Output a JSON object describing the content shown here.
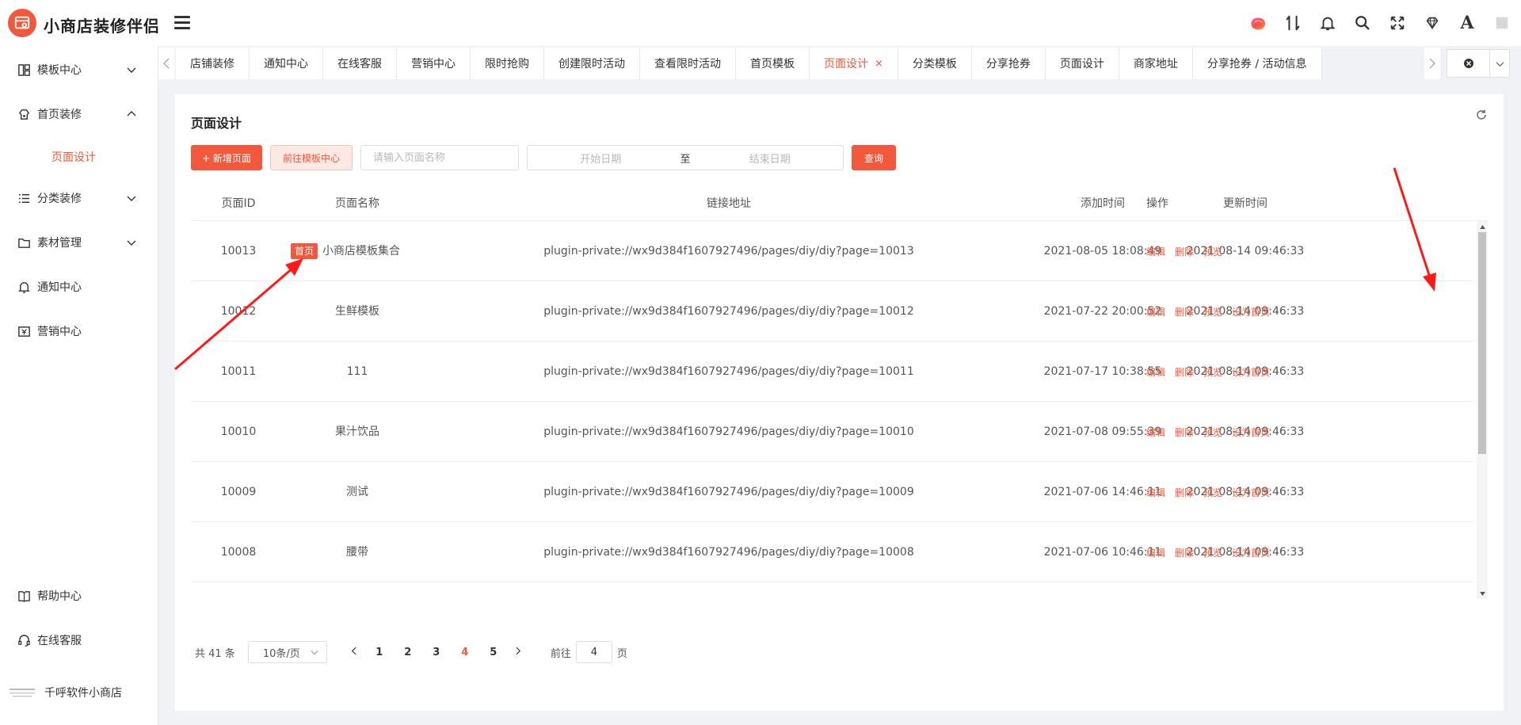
{
  "app": {
    "brand": "小商店装修伴侣"
  },
  "sidebar": {
    "items": [
      {
        "label": "模板中心"
      },
      {
        "label": "首页装修"
      },
      {
        "label": "页面设计"
      },
      {
        "label": "分类装修"
      },
      {
        "label": "素材管理"
      },
      {
        "label": "通知中心"
      },
      {
        "label": "营销中心"
      },
      {
        "label": "帮助中心"
      },
      {
        "label": "在线客服"
      }
    ],
    "footer": {
      "label": "千呼软件小商店"
    }
  },
  "tabs": [
    {
      "label": "店铺装修"
    },
    {
      "label": "通知中心"
    },
    {
      "label": "在线客服"
    },
    {
      "label": "营销中心"
    },
    {
      "label": "限时抢购"
    },
    {
      "label": "创建限时活动"
    },
    {
      "label": "查看限时活动"
    },
    {
      "label": "首页模板"
    },
    {
      "label": "页面设计",
      "close": "×"
    },
    {
      "label": "分类模板"
    },
    {
      "label": "分享抢券"
    },
    {
      "label": "页面设计"
    },
    {
      "label": "商家地址"
    },
    {
      "label": "分享抢券 / 活动信息"
    }
  ],
  "page": {
    "title": "页面设计",
    "add_button": "+ 新增页面",
    "template_button": "前往模板中心",
    "search_placeholder": "请输入页面名称",
    "start_date_placeholder": "开始日期",
    "date_separator": "至",
    "end_date_placeholder": "结束日期",
    "query_button": "查询"
  },
  "table": {
    "headers": {
      "id": "页面ID",
      "name": "页面名称",
      "link": "链接地址",
      "added": "添加时间",
      "updated": "更新时间",
      "ops": "操作"
    },
    "op_labels": {
      "edit": "编辑",
      "delete": "删除",
      "preview": "预览",
      "set_home": "设为首页"
    },
    "home_badge": "首页",
    "rows": [
      {
        "id": "10013",
        "name": "小商店模板集合",
        "link": "plugin-private://wx9d384f1607927496/pages/diy/diy?page=10013",
        "added": "2021-08-05 18:08:49",
        "updated": "2021-08-14 09:46:33",
        "is_home": true
      },
      {
        "id": "10012",
        "name": "生鲜模板",
        "link": "plugin-private://wx9d384f1607927496/pages/diy/diy?page=10012",
        "added": "2021-07-22 20:00:52",
        "updated": "2021-08-14 09:46:33",
        "is_home": false
      },
      {
        "id": "10011",
        "name": "111",
        "link": "plugin-private://wx9d384f1607927496/pages/diy/diy?page=10011",
        "added": "2021-07-17 10:38:55",
        "updated": "2021-08-14 09:46:33",
        "is_home": false
      },
      {
        "id": "10010",
        "name": "果汁饮品",
        "link": "plugin-private://wx9d384f1607927496/pages/diy/diy?page=10010",
        "added": "2021-07-08 09:55:39",
        "updated": "2021-08-14 09:46:33",
        "is_home": false
      },
      {
        "id": "10009",
        "name": "测试",
        "link": "plugin-private://wx9d384f1607927496/pages/diy/diy?page=10009",
        "added": "2021-07-06 14:46:11",
        "updated": "2021-08-14 09:46:33",
        "is_home": false
      },
      {
        "id": "10008",
        "name": "腰带",
        "link": "plugin-private://wx9d384f1607927496/pages/diy/diy?page=10008",
        "added": "2021-07-06 10:46:11",
        "updated": "2021-08-14 09:46:33",
        "is_home": false
      }
    ]
  },
  "pagination": {
    "total": "共 41 条",
    "page_size": "10条/页",
    "pages": [
      "1",
      "2",
      "3",
      "4",
      "5"
    ],
    "current": "4",
    "goto_label": "前往",
    "goto_value": "4",
    "page_unit": "页"
  },
  "colors": {
    "accent": "#f2593c"
  }
}
